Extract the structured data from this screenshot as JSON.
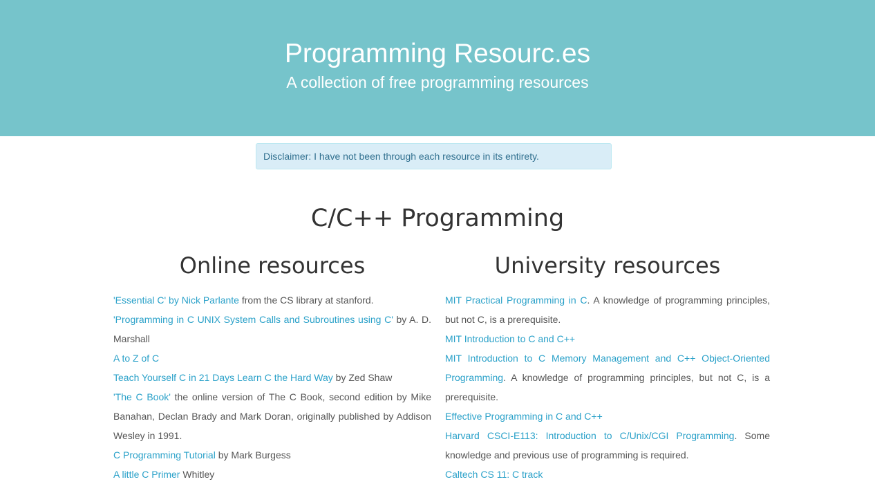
{
  "hero": {
    "title": "Programming Resourc.es",
    "subtitle": "A collection of free programming resources"
  },
  "alert": {
    "text": "Disclaimer: I have not been through each resource in its entirety."
  },
  "section": {
    "title": "C/C++ Programming"
  },
  "online": {
    "heading": "Online resources",
    "items": [
      {
        "link": "'Essential C' by Nick Parlante",
        "text": " from the CS library at stanford."
      },
      {
        "link": "'Programming in C UNIX System Calls and Subroutines using C'",
        "text": " by A. D. Marshall"
      },
      {
        "link": "A to Z of C",
        "text": ""
      },
      {
        "link": "Teach Yourself C in 21 Days",
        "link2": "Learn C the Hard Way",
        "text": " by Zed Shaw"
      },
      {
        "link": "'The C Book'",
        "text": " the online version of The C Book, second edition by Mike Banahan, Declan Brady and Mark Doran, originally published by Addison Wesley in 1991."
      },
      {
        "link": "C Programming Tutorial",
        "text": " by Mark Burgess"
      },
      {
        "link": "A little C Primer",
        "text": " Whitley"
      }
    ]
  },
  "university": {
    "heading": "University resources",
    "items": [
      {
        "link": "MIT Practical Programming in C",
        "text": ". A knowledge of programming principles, but not C, is a prerequisite."
      },
      {
        "link": "MIT Introduction to C and C++",
        "text": ""
      },
      {
        "link": "MIT Introduction to C Memory Management and C++ Object-Oriented Programming",
        "text": ". A knowledge of programming principles, but not C, is a prerequisite."
      },
      {
        "link": "Effective Programming in C and C++",
        "text": ""
      },
      {
        "link": "Harvard CSCI-E113: Introduction to C/Unix/CGI Programming",
        "text": ".  Some knowledge and previous use of programming is required."
      },
      {
        "link": "Caltech CS 11: C track",
        "text": ""
      }
    ]
  }
}
